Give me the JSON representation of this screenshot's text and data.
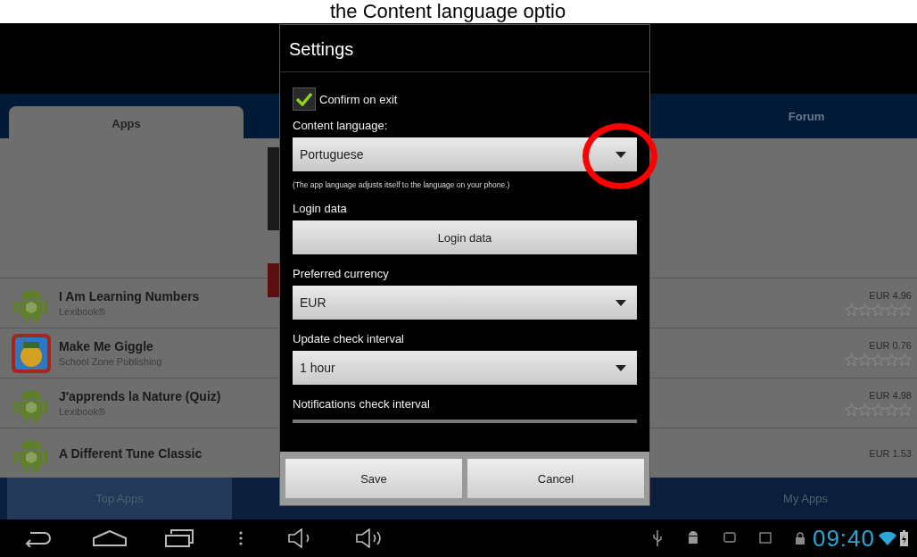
{
  "caption": "the Content language optio",
  "tabs": [
    {
      "label": "Apps",
      "selected": true
    },
    {
      "label": "Forum",
      "selected": false
    }
  ],
  "apps": [
    {
      "name": "I Am Learning Numbers",
      "publisher": "Lexibook®",
      "price": "EUR 4.96",
      "stars": 0,
      "kind": "android"
    },
    {
      "name": "Make Me Giggle",
      "publisher": "School Zone Publishing",
      "price": "EUR 0.76",
      "stars": 0,
      "kind": "picture"
    },
    {
      "name": "J'apprends la Nature (Quiz)",
      "publisher": "Lexibook®",
      "price": "EUR 4.98",
      "stars": 0,
      "kind": "android"
    },
    {
      "name": "A Different Tune Classic",
      "price": "EUR 1.53",
      "kind": "android"
    }
  ],
  "bottom_tabs": [
    {
      "label": "Top Apps",
      "selected": true
    },
    {
      "label": "My Apps",
      "selected": false
    }
  ],
  "dialog": {
    "title": "Settings",
    "confirm_on_exit": {
      "label": "Confirm on exit",
      "checked": true
    },
    "content_language": {
      "label": "Content language:",
      "value": "Portuguese",
      "note": "(The app language adjusts itself to the language on your phone.)",
      "highlighted": true
    },
    "login": {
      "label": "Login data",
      "button": "Login data"
    },
    "currency": {
      "label": "Preferred currency",
      "value": "EUR"
    },
    "update_interval": {
      "label": "Update check interval",
      "value": "1 hour"
    },
    "notifications_interval": {
      "label": "Notifications check interval"
    },
    "buttons": [
      "Save",
      "Cancel"
    ]
  },
  "status_bar": {
    "time": "09:40"
  }
}
